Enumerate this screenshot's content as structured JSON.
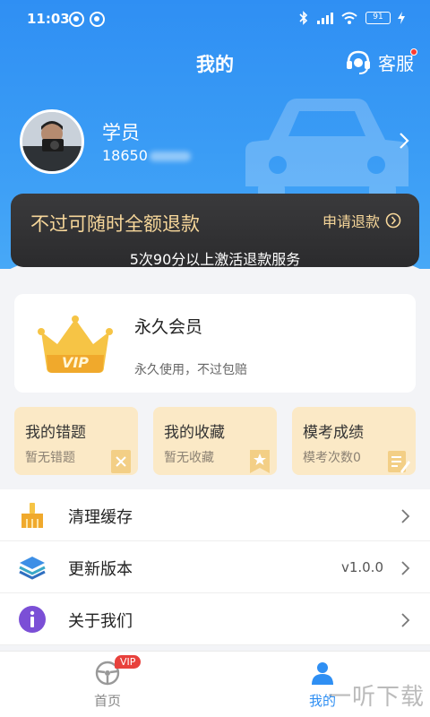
{
  "status_bar": {
    "time": "11:03",
    "battery": "91"
  },
  "header": {
    "title": "我的",
    "service_label": "客服"
  },
  "profile": {
    "name": "学员",
    "phone": "18650"
  },
  "refund": {
    "title": "不过可随时全额退款",
    "apply_label": "申请退款",
    "subtitle": "5次90分以上激活退款服务"
  },
  "vip": {
    "title": "永久会员",
    "subtitle": "永久使用，不过包赔",
    "crown_text": "VIP"
  },
  "quick_cards": [
    {
      "title": "我的错题",
      "subtitle": "暂无错题",
      "icon": "book-icon"
    },
    {
      "title": "我的收藏",
      "subtitle": "暂无收藏",
      "icon": "bookmark-star-icon"
    },
    {
      "title": "模考成绩",
      "subtitle": "模考次数0",
      "icon": "notepad-pencil-icon"
    }
  ],
  "menu": [
    {
      "label": "清理缓存",
      "value": "",
      "icon": "broom-icon"
    },
    {
      "label": "更新版本",
      "value": "v1.0.0",
      "icon": "layers-icon"
    },
    {
      "label": "关于我们",
      "value": "",
      "icon": "info-icon"
    }
  ],
  "tabbar": {
    "home_label": "首页",
    "home_badge": "VIP",
    "mine_label": "我的",
    "watermark": "一听下载"
  },
  "colors": {
    "header_blue": "#2f8ff3",
    "refund_gold": "#f7d79a",
    "quick_card_bg": "#fbe9c6",
    "tab_active": "#2f8ff3",
    "badge_red": "#e8413c"
  }
}
